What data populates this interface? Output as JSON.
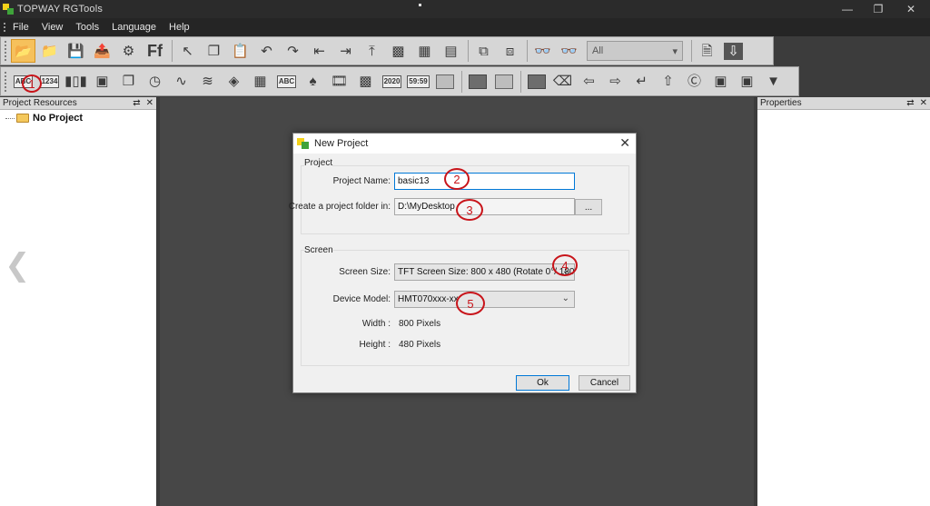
{
  "window": {
    "title": "TOPWAY RGTools",
    "logo_colors": [
      "#f4d21a",
      "#3fa33a"
    ],
    "min_icon": "minimize-icon",
    "restore_icon": "restore-icon",
    "close_icon": "close-icon"
  },
  "menu": [
    "File",
    "View",
    "Tools",
    "Language",
    "Help"
  ],
  "toolbar1": {
    "combo_value": "All"
  },
  "toolbar2": {
    "abc_label": "ABC",
    "num_label": "1234",
    "date_label": "2020",
    "time_label": "59:59",
    "text_label": "ABC"
  },
  "left_panel": {
    "title": "Project Resources",
    "tree_item": "No Project"
  },
  "right_panel": {
    "title": "Properties"
  },
  "dialog": {
    "title": "New Project",
    "project_group": "Project",
    "project_name_label": "Project Name:",
    "project_name_value": "basic13",
    "folder_label": "Create a project folder in:",
    "folder_value": "D:\\MyDesktop",
    "browse_label": "...",
    "screen_group": "Screen",
    "screen_size_label": "Screen Size:",
    "screen_size_value": "TFT Screen Size: 800 x 480 (Rotate 0°/ 180°)",
    "device_model_label": "Device Model:",
    "device_model_value": "HMT070xxx-xx",
    "width_label": "Width :",
    "width_value": "800 Pixels",
    "height_label": "Height :",
    "height_value": "480 Pixels",
    "ok_label": "Ok",
    "cancel_label": "Cancel"
  },
  "annotations": [
    "1",
    "2",
    "3",
    "4",
    "5"
  ],
  "colors": {
    "annotation": "#c8141a",
    "ok_border": "#0078d7",
    "highlight": "#f6c15c"
  }
}
